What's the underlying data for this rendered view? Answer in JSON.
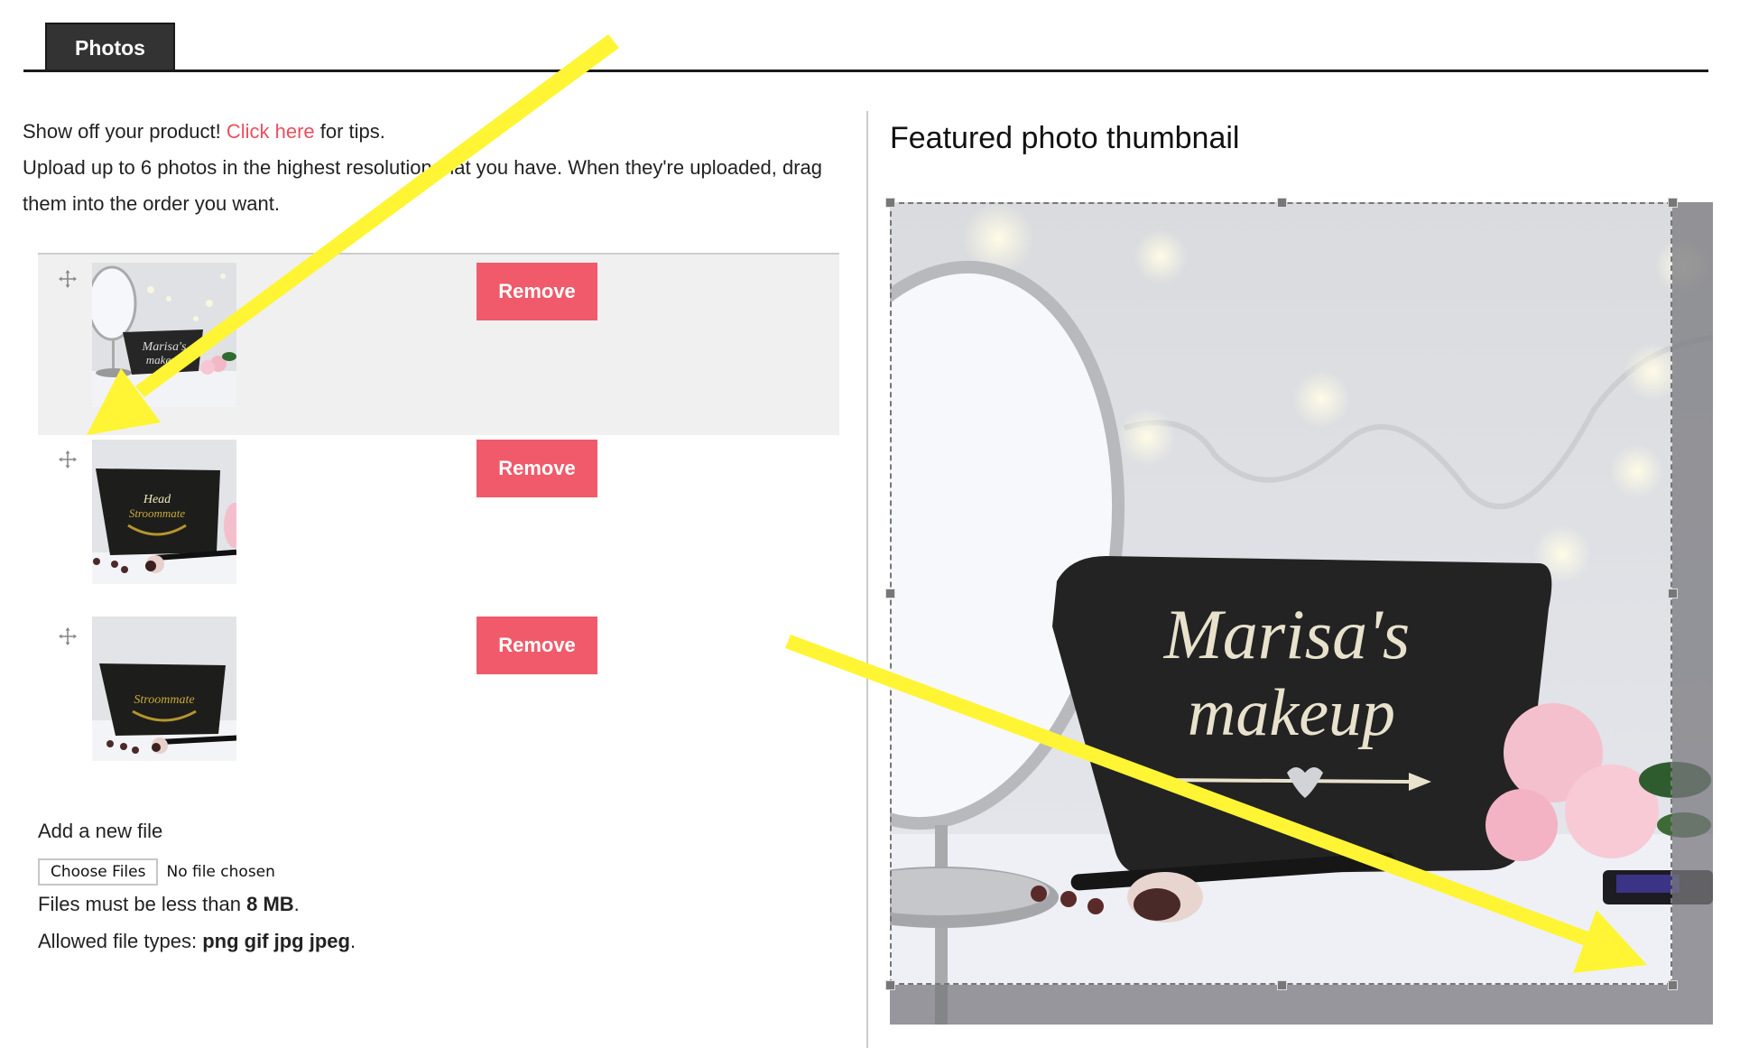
{
  "tabs": [
    {
      "label": "Photos",
      "active": true
    }
  ],
  "intro": {
    "line1_prefix": "Show off your product! ",
    "tips_link": "Click here",
    "line1_suffix": " for tips.",
    "line2": "Upload up to 6 photos in the highest resolution that you have. When they're uploaded, drag them into the order you want."
  },
  "photos": [
    {
      "alt": "Marisa's makeup bag with mirror",
      "remove_label": "Remove",
      "drag_icon": "move-icon"
    },
    {
      "alt": "Black makeup bag with gold script",
      "remove_label": "Remove",
      "drag_icon": "move-icon"
    },
    {
      "alt": "Black makeup bag with gold wreath",
      "remove_label": "Remove",
      "drag_icon": "move-icon"
    }
  ],
  "add_file": {
    "title": "Add a new file",
    "choose_button": "Choose Files",
    "no_file_text": "No file chosen",
    "size_prefix": "Files must be less than ",
    "size_value": "8 MB",
    "size_suffix": ".",
    "types_prefix": "Allowed file types: ",
    "types_value": "png gif jpg jpeg",
    "types_suffix": "."
  },
  "featured": {
    "title": "Featured photo thumbnail",
    "bag_text_line1": "Marisa's",
    "bag_text_line2": "makeup"
  },
  "colors": {
    "accent": "#f05a6a",
    "tab_bg": "#333333",
    "annotation_arrow": "#fff534",
    "row_active_bg": "#f0f0f0"
  }
}
